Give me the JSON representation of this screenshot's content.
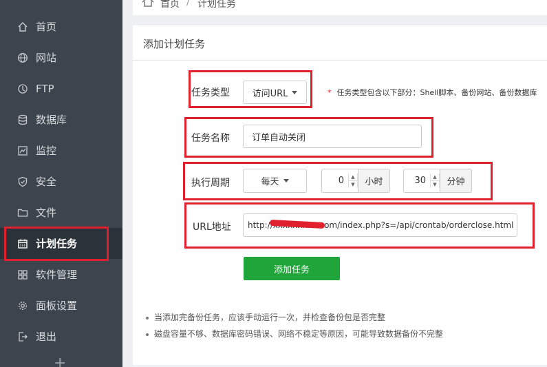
{
  "sidebar": {
    "items": [
      {
        "label": "首页",
        "icon": "home-icon"
      },
      {
        "label": "网站",
        "icon": "globe-icon"
      },
      {
        "label": "FTP",
        "icon": "ftp-icon"
      },
      {
        "label": "数据库",
        "icon": "database-icon"
      },
      {
        "label": "监控",
        "icon": "monitor-icon"
      },
      {
        "label": "安全",
        "icon": "shield-icon"
      },
      {
        "label": "文件",
        "icon": "folder-icon"
      },
      {
        "label": "计划任务",
        "icon": "calendar-icon",
        "active": true
      },
      {
        "label": "软件管理",
        "icon": "apps-icon"
      },
      {
        "label": "面板设置",
        "icon": "gear-icon"
      },
      {
        "label": "退出",
        "icon": "logout-icon"
      }
    ],
    "more": "+"
  },
  "breadcrumb": {
    "home": "首页",
    "sep": "/",
    "current": "计划任务"
  },
  "panel": {
    "title": "添加计划任务"
  },
  "form": {
    "task_type_label": "任务类型",
    "task_type_value": "访问URL",
    "task_type_hint_star": "*",
    "task_type_hint": "任务类型包含以下部分：Shell脚本、备份网站、备份数据库",
    "task_name_label": "任务名称",
    "task_name_value": "订单自动关闭",
    "period_label": "执行周期",
    "period_value": "每天",
    "hour_value": "0",
    "hour_unit": "小时",
    "minute_value": "30",
    "minute_unit": "分钟",
    "url_label": "URL地址",
    "url_value": "http://xxxxxxxxx.com/index.php?s=/api/crontab/orderclose.html",
    "submit_label": "添加任务"
  },
  "tips": [
    "当添加完备份任务，应该手动运行一次，并检查备份包是否完整",
    "磁盘容量不够、数据库密码错误、网络不稳定等原因，可能导致数据备份不完整"
  ],
  "colors": {
    "sidebar_bg": "#3c444d",
    "accent_green": "#20a53a",
    "highlight_red": "#e0202d"
  }
}
